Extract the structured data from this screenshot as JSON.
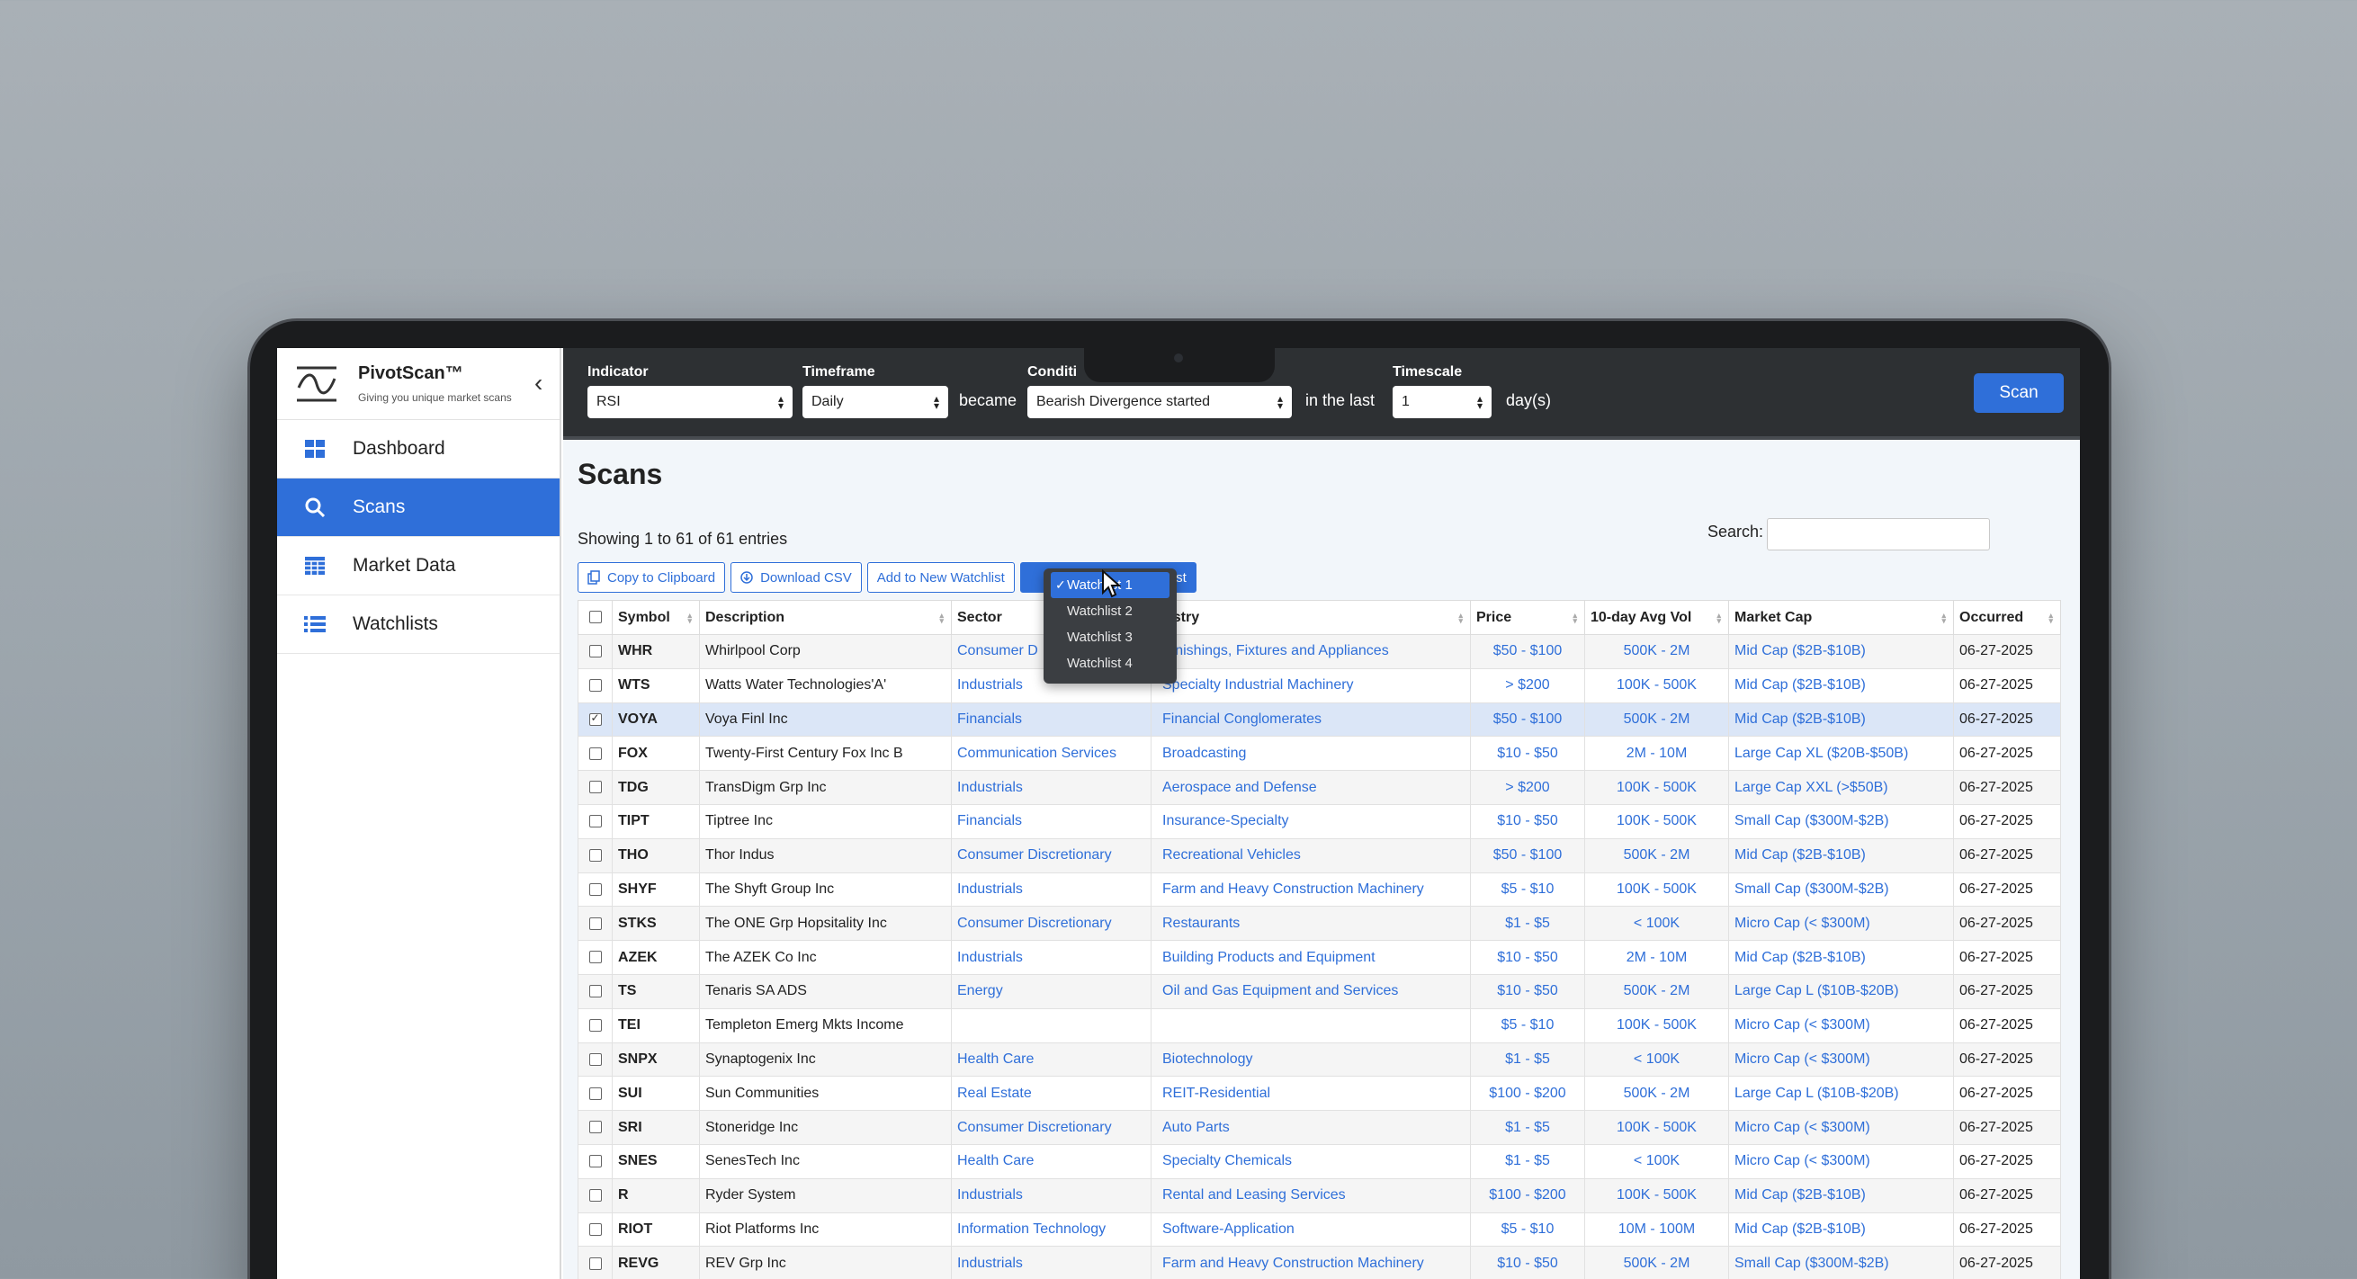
{
  "app": {
    "name": "PivotScan™",
    "tagline": "Giving you unique market scans"
  },
  "sidebar": {
    "items": [
      {
        "label": "Dashboard",
        "icon": "dashboard-grid-icon",
        "active": false
      },
      {
        "label": "Scans",
        "icon": "search-icon",
        "active": true
      },
      {
        "label": "Market Data",
        "icon": "table-icon",
        "active": false
      },
      {
        "label": "Watchlists",
        "icon": "list-icon",
        "active": false
      }
    ]
  },
  "topbar": {
    "indicator_label": "Indicator",
    "indicator_value": "RSI",
    "timeframe_label": "Timeframe",
    "timeframe_value": "Daily",
    "became_text": "became",
    "condition_label": "Conditi",
    "condition_value": "Bearish Divergence started",
    "in_last_text": "in the last",
    "timescale_label": "Timescale",
    "timescale_value": "1",
    "days_text": "day(s)",
    "scan_label": "Scan"
  },
  "main": {
    "title": "Scans",
    "entries_text": "Showing 1 to 61 of 61 entries",
    "search_label": "Search:",
    "search_value": "",
    "buttons": {
      "copy": "Copy to Clipboard",
      "download": "Download CSV",
      "add_new": "Add to New Watchlist",
      "add_existing_visible": "tchlist"
    },
    "dropdown": {
      "items": [
        "Watchlist 1",
        "Watchlist 2",
        "Watchlist 3",
        "Watchlist 4"
      ],
      "selected": "Watchlist 1"
    }
  },
  "table": {
    "headers": {
      "symbol": "Symbol",
      "description": "Description",
      "sector": "Sector",
      "industry": "ustry",
      "price": "Price",
      "vol": "10-day Avg Vol",
      "cap": "Market Cap",
      "occurred": "Occurred"
    },
    "rows": [
      {
        "symbol": "WHR",
        "description": "Whirlpool Corp",
        "sector": "Consumer D",
        "industry": "urnishings, Fixtures and Appliances",
        "price": "$50 - $100",
        "vol": "500K - 2M",
        "cap": "Mid Cap ($2B-$10B)",
        "occurred": "06-27-2025",
        "checked": false
      },
      {
        "symbol": "WTS",
        "description": "Watts Water Technologies'A'",
        "sector": "Industrials",
        "industry": "Specialty Industrial Machinery",
        "price": "> $200",
        "vol": "100K - 500K",
        "cap": "Mid Cap ($2B-$10B)",
        "occurred": "06-27-2025",
        "checked": false
      },
      {
        "symbol": "VOYA",
        "description": "Voya Finl Inc",
        "sector": "Financials",
        "industry": "Financial Conglomerates",
        "price": "$50 - $100",
        "vol": "500K - 2M",
        "cap": "Mid Cap ($2B-$10B)",
        "occurred": "06-27-2025",
        "checked": true
      },
      {
        "symbol": "FOX",
        "description": "Twenty-First Century Fox Inc B",
        "sector": "Communication Services",
        "industry": "Broadcasting",
        "price": "$10 - $50",
        "vol": "2M - 10M",
        "cap": "Large Cap XL ($20B-$50B)",
        "occurred": "06-27-2025",
        "checked": false
      },
      {
        "symbol": "TDG",
        "description": "TransDigm Grp Inc",
        "sector": "Industrials",
        "industry": "Aerospace and Defense",
        "price": "> $200",
        "vol": "100K - 500K",
        "cap": "Large Cap XXL (>$50B)",
        "occurred": "06-27-2025",
        "checked": false
      },
      {
        "symbol": "TIPT",
        "description": "Tiptree Inc",
        "sector": "Financials",
        "industry": "Insurance-Specialty",
        "price": "$10 - $50",
        "vol": "100K - 500K",
        "cap": "Small Cap ($300M-$2B)",
        "occurred": "06-27-2025",
        "checked": false
      },
      {
        "symbol": "THO",
        "description": "Thor Indus",
        "sector": "Consumer Discretionary",
        "industry": "Recreational Vehicles",
        "price": "$50 - $100",
        "vol": "500K - 2M",
        "cap": "Mid Cap ($2B-$10B)",
        "occurred": "06-27-2025",
        "checked": false
      },
      {
        "symbol": "SHYF",
        "description": "The Shyft Group Inc",
        "sector": "Industrials",
        "industry": "Farm and Heavy Construction Machinery",
        "price": "$5 - $10",
        "vol": "100K - 500K",
        "cap": "Small Cap ($300M-$2B)",
        "occurred": "06-27-2025",
        "checked": false
      },
      {
        "symbol": "STKS",
        "description": "The ONE Grp Hopsitality Inc",
        "sector": "Consumer Discretionary",
        "industry": "Restaurants",
        "price": "$1 - $5",
        "vol": "< 100K",
        "cap": "Micro Cap (< $300M)",
        "occurred": "06-27-2025",
        "checked": false
      },
      {
        "symbol": "AZEK",
        "description": "The AZEK Co Inc",
        "sector": "Industrials",
        "industry": "Building Products and Equipment",
        "price": "$10 - $50",
        "vol": "2M - 10M",
        "cap": "Mid Cap ($2B-$10B)",
        "occurred": "06-27-2025",
        "checked": false
      },
      {
        "symbol": "TS",
        "description": "Tenaris SA ADS",
        "sector": "Energy",
        "industry": "Oil and Gas Equipment and Services",
        "price": "$10 - $50",
        "vol": "500K - 2M",
        "cap": "Large Cap L ($10B-$20B)",
        "occurred": "06-27-2025",
        "checked": false
      },
      {
        "symbol": "TEI",
        "description": "Templeton Emerg Mkts Income",
        "sector": "",
        "industry": "",
        "price": "$5 - $10",
        "vol": "100K - 500K",
        "cap": "Micro Cap (< $300M)",
        "occurred": "06-27-2025",
        "checked": false
      },
      {
        "symbol": "SNPX",
        "description": "Synaptogenix Inc",
        "sector": "Health Care",
        "industry": "Biotechnology",
        "price": "$1 - $5",
        "vol": "< 100K",
        "cap": "Micro Cap (< $300M)",
        "occurred": "06-27-2025",
        "checked": false
      },
      {
        "symbol": "SUI",
        "description": "Sun Communities",
        "sector": "Real Estate",
        "industry": "REIT-Residential",
        "price": "$100 - $200",
        "vol": "500K - 2M",
        "cap": "Large Cap L ($10B-$20B)",
        "occurred": "06-27-2025",
        "checked": false
      },
      {
        "symbol": "SRI",
        "description": "Stoneridge Inc",
        "sector": "Consumer Discretionary",
        "industry": "Auto Parts",
        "price": "$1 - $5",
        "vol": "100K - 500K",
        "cap": "Micro Cap (< $300M)",
        "occurred": "06-27-2025",
        "checked": false
      },
      {
        "symbol": "SNES",
        "description": "SenesTech Inc",
        "sector": "Health Care",
        "industry": "Specialty Chemicals",
        "price": "$1 - $5",
        "vol": "< 100K",
        "cap": "Micro Cap (< $300M)",
        "occurred": "06-27-2025",
        "checked": false
      },
      {
        "symbol": "R",
        "description": "Ryder System",
        "sector": "Industrials",
        "industry": "Rental and Leasing Services",
        "price": "$100 - $200",
        "vol": "100K - 500K",
        "cap": "Mid Cap ($2B-$10B)",
        "occurred": "06-27-2025",
        "checked": false
      },
      {
        "symbol": "RIOT",
        "description": "Riot Platforms Inc",
        "sector": "Information Technology",
        "industry": "Software-Application",
        "price": "$5 - $10",
        "vol": "10M - 100M",
        "cap": "Mid Cap ($2B-$10B)",
        "occurred": "06-27-2025",
        "checked": false
      },
      {
        "symbol": "REVG",
        "description": "REV Grp Inc",
        "sector": "Industrials",
        "industry": "Farm and Heavy Construction Machinery",
        "price": "$10 - $50",
        "vol": "500K - 2M",
        "cap": "Small Cap ($300M-$2B)",
        "occurred": "06-27-2025",
        "checked": false
      }
    ]
  },
  "colors": {
    "accent": "#2f6fd9",
    "topbar": "#2d3033",
    "selected_row": "#dbe6f7"
  }
}
